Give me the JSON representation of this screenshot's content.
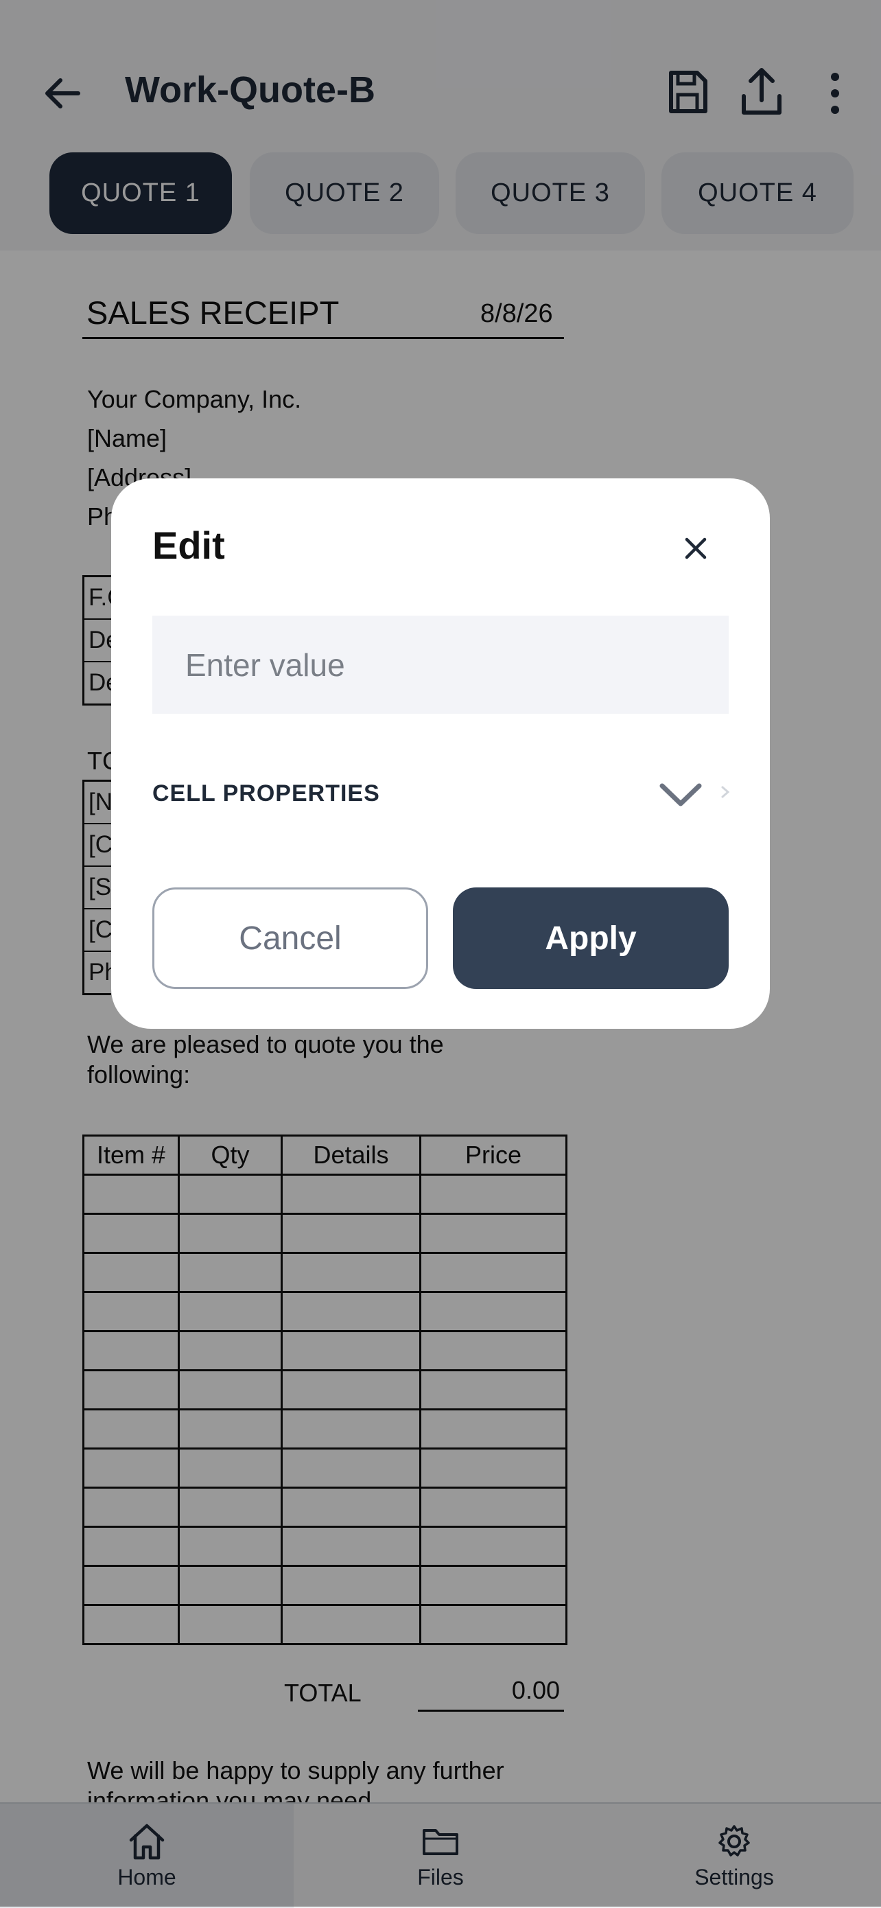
{
  "header": {
    "title": "Work-Quote-B",
    "tabs": [
      {
        "label": "QUOTE 1",
        "active": true
      },
      {
        "label": "QUOTE 2",
        "active": false
      },
      {
        "label": "QUOTE 3",
        "active": false
      },
      {
        "label": "QUOTE 4",
        "active": false
      }
    ],
    "icons": [
      "back-arrow-icon",
      "save-icon",
      "share-icon",
      "more-vertical-icon"
    ]
  },
  "document": {
    "title": "SALES RECEIPT",
    "date": "8/8/26",
    "company": {
      "name": "Your Company, Inc.",
      "name_field": "[Name]",
      "address_field": "[Address]",
      "phone_prefix": "Ph"
    },
    "from_box": [
      "F.C",
      "De",
      "De"
    ],
    "to_label": "TC",
    "to_box": [
      "[N",
      "[C",
      "[S",
      "[C",
      "Ph"
    ],
    "intro": "We are pleased to quote you the following:",
    "items_table": {
      "headers": [
        "Item #",
        "Qty",
        "Details",
        "Price"
      ],
      "empty_row_count": 12
    },
    "total_label": "TOTAL",
    "total_value": "0.00",
    "closing": "We will be happy to supply any further information you may need"
  },
  "modal": {
    "title": "Edit",
    "input_placeholder": "Enter value",
    "input_value": "",
    "cell_properties_label": "CELL PROPERTIES",
    "cancel_label": "Cancel",
    "apply_label": "Apply"
  },
  "bottom_nav": [
    {
      "label": "Home",
      "icon": "home-icon",
      "active": true
    },
    {
      "label": "Files",
      "icon": "folder-icon",
      "active": false
    },
    {
      "label": "Settings",
      "icon": "gear-icon",
      "active": false
    }
  ],
  "colors": {
    "primary_dark": "#334155",
    "active_tab": "#1f2a3d",
    "overlay": "rgba(0,0,0,0.4)"
  }
}
